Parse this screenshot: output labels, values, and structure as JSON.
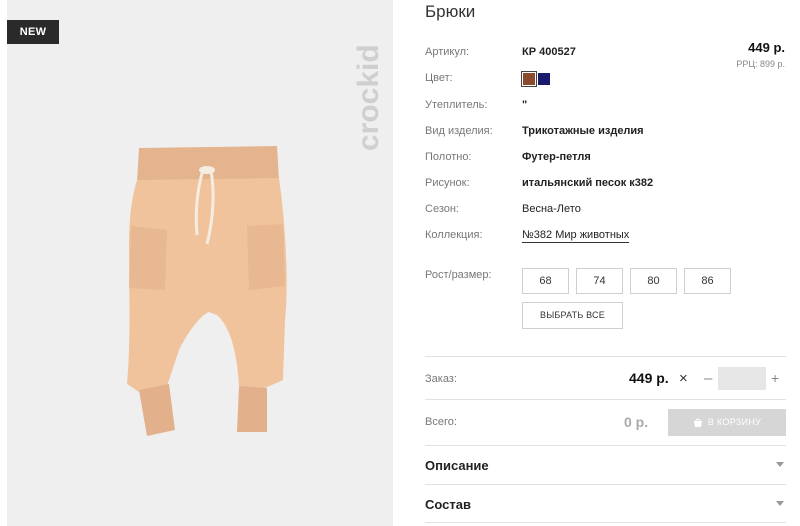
{
  "product": {
    "badge": "NEW",
    "brand": "crockid",
    "title": "Брюки",
    "price": "449 р.",
    "rrp": "РРЦ: 899 р.",
    "attributes": [
      {
        "label": "Артикул:",
        "value": "КР 400527"
      },
      {
        "label": "Цвет:",
        "value": ""
      },
      {
        "label": "Утеплитель:",
        "value": "\""
      },
      {
        "label": "Вид изделия:",
        "value": "Трикотажные изделия"
      },
      {
        "label": "Полотно:",
        "value": "Футер-петля"
      },
      {
        "label": "Рисунок:",
        "value": "итальянский песок к382"
      },
      {
        "label": "Сезон:",
        "value": "Весна-Лето"
      },
      {
        "label": "Коллекция:",
        "value": "№382 Мир животных"
      }
    ],
    "colors": [
      "#8b4a2b",
      "#1a1a6e"
    ]
  },
  "sizes": {
    "label": "Рост/размер:",
    "options": [
      "68",
      "74",
      "80",
      "86"
    ],
    "select_all": "ВЫБРАТЬ ВСЕ"
  },
  "order": {
    "label": "Заказ:",
    "price": "449 р.",
    "times": "×",
    "minus": "–",
    "quantity": "",
    "plus": "+"
  },
  "total": {
    "label": "Всего:",
    "value": "0 р.",
    "cart_button": "В КОРЗИНУ"
  },
  "accordion": {
    "description": "Описание",
    "composition": "Состав"
  }
}
